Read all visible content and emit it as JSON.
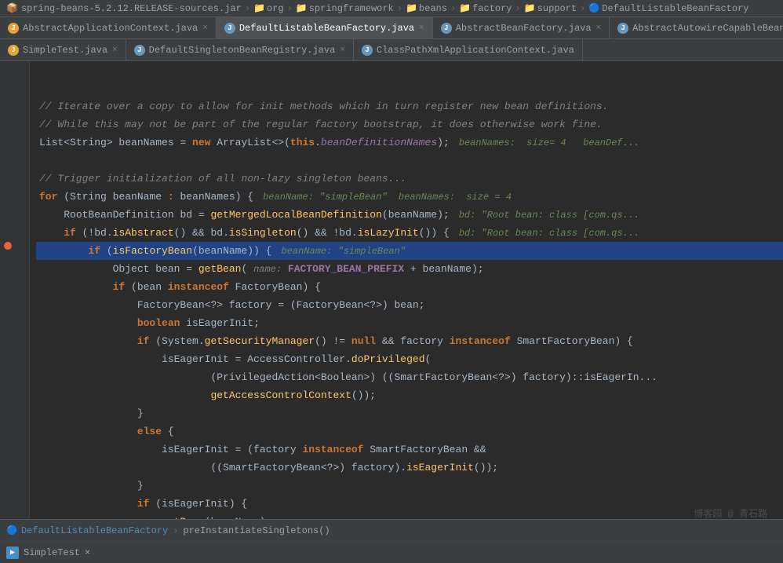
{
  "breadcrumb": {
    "items": [
      "spring-beans-5.2.12.RELEASE-sources.jar",
      "org",
      "springframework",
      "beans",
      "factory",
      "support",
      "DefaultListableBeanFactory"
    ]
  },
  "tabs_row1": [
    {
      "id": "tab1",
      "icon": "J",
      "icon_color": "orange",
      "label": "AbstractApplicationContext.java",
      "active": false,
      "closeable": true
    },
    {
      "id": "tab2",
      "icon": "J",
      "icon_color": "blue",
      "label": "DefaultListableBeanFactory.java",
      "active": true,
      "closeable": true
    },
    {
      "id": "tab3",
      "icon": "J",
      "icon_color": "blue",
      "label": "AbstractBeanFactory.java",
      "active": false,
      "closeable": true
    },
    {
      "id": "tab4",
      "icon": "J",
      "icon_color": "blue",
      "label": "AbstractAutowireCapableBeanFac...",
      "active": false,
      "closeable": false
    }
  ],
  "tabs_row2": [
    {
      "id": "tab5",
      "icon": "J",
      "icon_color": "orange",
      "label": "SimpleTest.java",
      "active": false,
      "closeable": true
    },
    {
      "id": "tab6",
      "icon": "J",
      "icon_color": "blue",
      "label": "DefaultSingletonBeanRegistry.java",
      "active": false,
      "closeable": true
    },
    {
      "id": "tab7",
      "icon": "J",
      "icon_color": "blue",
      "label": "ClassPathXmlApplicationContext.java",
      "active": false,
      "closeable": false
    }
  ],
  "code": {
    "lines": [
      {
        "num": "",
        "text": "",
        "type": "normal",
        "content_html": ""
      },
      {
        "num": "",
        "text": "",
        "type": "normal",
        "content_html": ""
      },
      {
        "num": "",
        "text": "// Iterate over a copy to allow for init methods which in turn register new bean definitions.",
        "type": "comment"
      },
      {
        "num": "",
        "text": "// While this may not be part of the regular factory bootstrap, it does otherwise work fine.",
        "type": "comment"
      },
      {
        "num": "",
        "text": "List<String> beanNames = new ArrayList<>(this.beanDefinitionNames);",
        "type": "normal",
        "debug": "beanNames:  size= 4   beanDef"
      },
      {
        "num": "",
        "text": "",
        "type": "normal"
      },
      {
        "num": "",
        "text": "// Trigger initialization of all non-lazy singleton beans...",
        "type": "comment"
      },
      {
        "num": "",
        "text": "for (String beanName : beanNames) {",
        "type": "normal",
        "debug": "beanName: \"simpleBean\"  beanNames:  size = 4"
      },
      {
        "num": "",
        "text": "    RootBeanDefinition bd = getMergedLocalBeanDefinition(beanName);",
        "type": "normal",
        "debug": "bd: \"Root bean: class [com.qs"
      },
      {
        "num": "",
        "text": "    if (!bd.isAbstract() && bd.isSingleton() && !bd.isLazyInit()) {",
        "type": "normal",
        "debug": "bd: \"Root bean: class [com.qs"
      },
      {
        "num": "highlighted",
        "text": "        if (isFactoryBean(beanName)) {",
        "type": "highlighted",
        "debug": "beanName: \"simpleBean\""
      },
      {
        "num": "",
        "text": "            Object bean = getBean( name: FACTORY_BEAN_PREFIX + beanName);",
        "type": "normal"
      },
      {
        "num": "",
        "text": "            if (bean instanceof FactoryBean) {",
        "type": "normal"
      },
      {
        "num": "",
        "text": "                FactoryBean<?> factory = (FactoryBean<?>) bean;",
        "type": "normal"
      },
      {
        "num": "",
        "text": "                boolean isEagerInit;",
        "type": "normal"
      },
      {
        "num": "",
        "text": "                if (System.getSecurityManager() != null && factory instanceof SmartFactoryBean) {",
        "type": "normal"
      },
      {
        "num": "",
        "text": "                    isEagerInit = AccessController.doPrivileged(",
        "type": "normal"
      },
      {
        "num": "",
        "text": "                            (PrivilegedAction<Boolean>) ((SmartFactoryBean<?>) factory)::isEagerIn",
        "type": "normal"
      },
      {
        "num": "",
        "text": "                            getAccessControlContext());",
        "type": "normal"
      },
      {
        "num": "",
        "text": "                }",
        "type": "normal"
      },
      {
        "num": "",
        "text": "                else {",
        "type": "normal"
      },
      {
        "num": "",
        "text": "                    isEagerInit = (factory instanceof SmartFactoryBean &&",
        "type": "normal"
      },
      {
        "num": "",
        "text": "                            ((SmartFactoryBean<?>) factory).isEagerInit());",
        "type": "normal"
      },
      {
        "num": "",
        "text": "                }",
        "type": "normal"
      },
      {
        "num": "",
        "text": "                if (isEagerInit) {",
        "type": "normal"
      },
      {
        "num": "",
        "text": "                    getBean(beanName);",
        "type": "normal"
      }
    ]
  },
  "bottom_breadcrumb": {
    "class": "DefaultListableBeanFactory",
    "method": "preInstantiateSingletons()"
  },
  "status_bar": {
    "label": "SimpleTest",
    "close": "×"
  },
  "watermark": "博客园 @ 青石路"
}
